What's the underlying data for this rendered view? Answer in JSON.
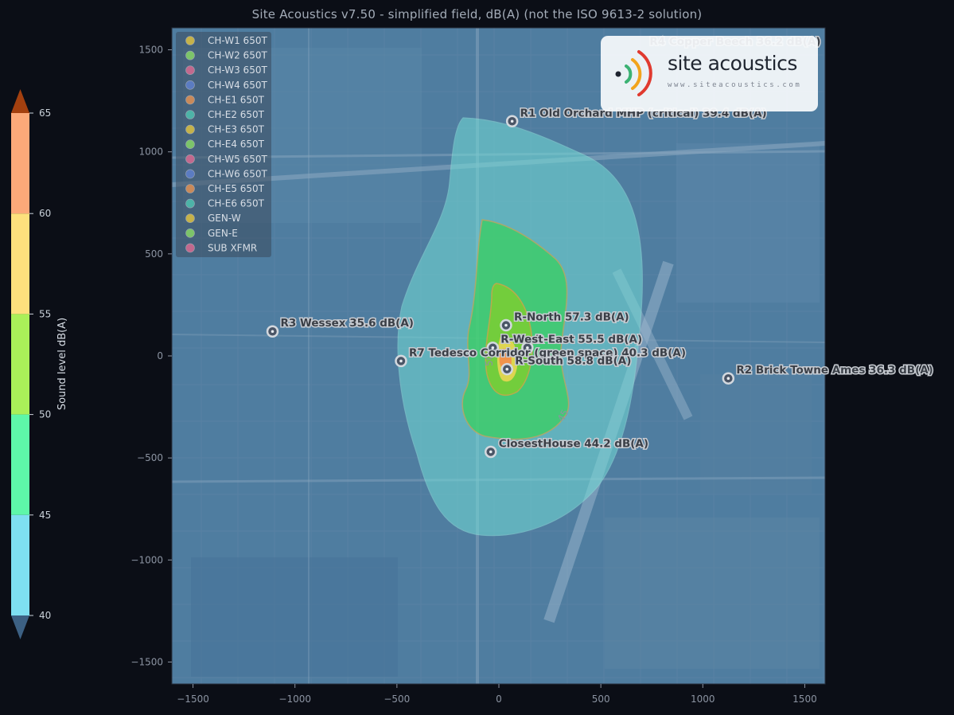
{
  "title": "Site Acoustics v7.50  -  simplified field, dB(A) (not the ISO 9613-2 solution)",
  "logo": {
    "word": "site acoustics",
    "url": "www.siteacoustics.com"
  },
  "axes": {
    "x_ticks": [
      -1500,
      -1000,
      -500,
      0,
      500,
      1000,
      1500
    ],
    "y_ticks": [
      1500,
      1000,
      500,
      0,
      -500,
      -1000,
      -1500
    ],
    "x_tick_labels": [
      "−1500",
      "−1000",
      "−500",
      "0",
      "500",
      "1000",
      "1500"
    ],
    "y_tick_labels": [
      "1500",
      "1000",
      "500",
      "0",
      "−500",
      "−1000",
      "−1500"
    ],
    "xlim": [
      -1600,
      1600
    ],
    "ylim": [
      -1600,
      1600
    ]
  },
  "legend": [
    {
      "label": "CH-W1 650T",
      "color": "#c5b24a"
    },
    {
      "label": "CH-W2 650T",
      "color": "#7cc46a"
    },
    {
      "label": "CH-W3 650T",
      "color": "#c2698e"
    },
    {
      "label": "CH-W4 650T",
      "color": "#5b7cc2"
    },
    {
      "label": "CH-E1 650T",
      "color": "#c98a5a"
    },
    {
      "label": "CH-E2 650T",
      "color": "#4db3a8"
    },
    {
      "label": "CH-E3 650T",
      "color": "#c5b24a"
    },
    {
      "label": "CH-E4 650T",
      "color": "#7cc46a"
    },
    {
      "label": "CH-W5 650T",
      "color": "#c2698e"
    },
    {
      "label": "CH-W6 650T",
      "color": "#5b7cc2"
    },
    {
      "label": "CH-E5 650T",
      "color": "#c98a5a"
    },
    {
      "label": "CH-E6 650T",
      "color": "#4db3a8"
    },
    {
      "label": "GEN-W",
      "color": "#c5b24a"
    },
    {
      "label": "GEN-E",
      "color": "#7cc46a"
    },
    {
      "label": "SUB XFMR",
      "color": "#c2698e"
    }
  ],
  "receivers": [
    {
      "label": "R4 Copper Beech  36.2 dB(A)",
      "x": 700,
      "y": 1500
    },
    {
      "label": "R1 Old Orchard MHP (critical)  39.4 dB(A)",
      "x": 65,
      "y": 1150
    },
    {
      "label": "R3 Wessex  35.6 dB(A)",
      "x": -1110,
      "y": 120
    },
    {
      "label": "R-North  57.3 dB(A)",
      "x": 35,
      "y": 150
    },
    {
      "label": "R-East  55.5 dB(A)",
      "x": 140,
      "y": 40
    },
    {
      "label": "R-West",
      "x": -30,
      "y": 40
    },
    {
      "label": "R7 Tedesco Corridor (green space)  40.3 dB(A)",
      "x": -480,
      "y": -25
    },
    {
      "label": "R-South  58.8 dB(A)",
      "x": 40,
      "y": -65
    },
    {
      "label": "R2 Brick Towne Ames  36.3 dB(A)",
      "x": 1125,
      "y": -110
    },
    {
      "label": "ClosestHouse  44.2 dB(A)",
      "x": -40,
      "y": -470
    }
  ],
  "contour_labels": [
    "50",
    "45"
  ],
  "colorbar": {
    "title": "Sound level  dB(A)",
    "ticks": [
      "65",
      "60",
      "55",
      "50",
      "45",
      "40"
    ],
    "bands": [
      {
        "from": 60,
        "to": 65,
        "color": "#fca979"
      },
      {
        "from": 55,
        "to": 60,
        "color": "#fde07d"
      },
      {
        "from": 50,
        "to": 55,
        "color": "#aaf059"
      },
      {
        "from": 45,
        "to": 50,
        "color": "#5ef7a9"
      },
      {
        "from": 40,
        "to": 45,
        "color": "#7edff1"
      }
    ],
    "over_color": "#a3400f",
    "under_color": "#3c6083"
  },
  "chart_data": {
    "type": "heatmap",
    "title": "Site Acoustics v7.50  -  simplified field, dB(A) (not the ISO 9613-2 solution)",
    "xlim": [
      -1600,
      1600
    ],
    "ylim": [
      -1600,
      1600
    ],
    "colorbar_label": "Sound level  dB(A)",
    "levels": [
      40,
      45,
      50,
      55,
      60,
      65
    ],
    "receivers": [
      {
        "name": "R4 Copper Beech",
        "level": 36.2
      },
      {
        "name": "R1 Old Orchard MHP (critical)",
        "level": 39.4
      },
      {
        "name": "R3 Wessex",
        "level": 35.6
      },
      {
        "name": "R-North",
        "level": 57.3
      },
      {
        "name": "R-East",
        "level": 55.5
      },
      {
        "name": "R7 Tedesco Corridor (green space)",
        "level": 40.3
      },
      {
        "name": "R-South",
        "level": 58.8
      },
      {
        "name": "R2 Brick Towne Ames",
        "level": 36.3
      },
      {
        "name": "ClosestHouse",
        "level": 44.2
      }
    ]
  }
}
